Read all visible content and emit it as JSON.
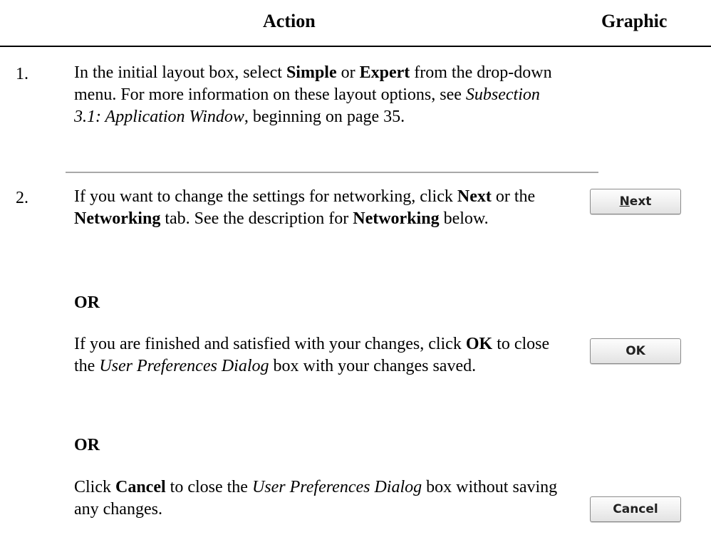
{
  "header": {
    "action": "Action",
    "graphic": "Graphic"
  },
  "steps": [
    {
      "number": "1.",
      "parts": [
        {
          "text": "In the initial layout box, select "
        },
        {
          "text": "Simple",
          "style": "b"
        },
        {
          "text": " or "
        },
        {
          "text": "Expert",
          "style": "b"
        },
        {
          "text": " from the drop-down menu. For more information on these layout options, see "
        },
        {
          "text": "Subsection 3.1: Application Window",
          "style": "i"
        },
        {
          "text": ", beginning on page 35."
        }
      ]
    },
    {
      "number": "2.",
      "parts": [
        {
          "text": "If you want to change the settings for networking, click "
        },
        {
          "text": "Next",
          "style": "b"
        },
        {
          "text": " or the "
        },
        {
          "text": "Networking",
          "style": "b"
        },
        {
          "text": " tab.  See the description for "
        },
        {
          "text": "Networking",
          "style": "b"
        },
        {
          "text": " below."
        }
      ]
    }
  ],
  "or_label": "OR",
  "option_ok": [
    {
      "text": "If you are finished and satisfied with your changes, click "
    },
    {
      "text": "OK",
      "style": "b"
    },
    {
      "text": " to close the "
    },
    {
      "text": "User Preferences Dialog",
      "style": "i"
    },
    {
      "text": " box with your changes saved."
    }
  ],
  "option_cancel": [
    {
      "text": "Click "
    },
    {
      "text": "Cancel",
      "style": "b"
    },
    {
      "text": " to close the "
    },
    {
      "text": "User Preferences Dialog",
      "style": "i"
    },
    {
      "text": " box without saving any changes."
    }
  ],
  "buttons": {
    "next_mnemonic": "N",
    "next_rest": "ext",
    "ok": "OK",
    "cancel": "Cancel"
  }
}
